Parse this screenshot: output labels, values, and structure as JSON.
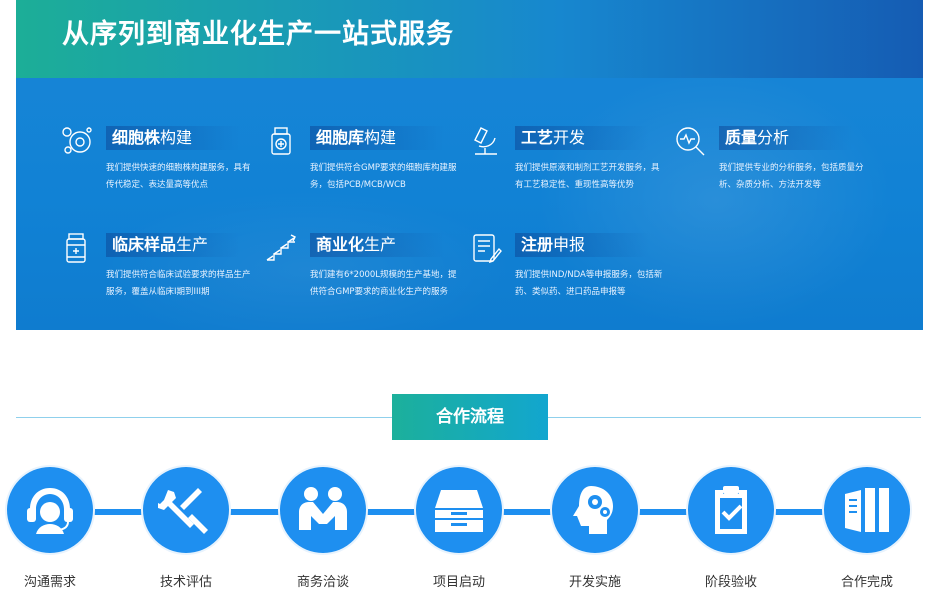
{
  "banner": {
    "title": "从序列到商业化生产一站式服务",
    "services": [
      {
        "icon": "cell-line-icon",
        "name_bold": "细胞株",
        "name_rest": "构建",
        "desc": "我们提供快速的细胞株构建服务，具有传代稳定、表达量高等优点"
      },
      {
        "icon": "cell-bank-icon",
        "name_bold": "细胞库",
        "name_rest": "构建",
        "desc": "我们提供符合GMP要求的细胞库构建服务，包括PCB/MCB/WCB"
      },
      {
        "icon": "microscope-icon",
        "name_bold": "工艺",
        "name_rest": "开发",
        "desc": "我们提供原液和制剂工艺开发服务，具有工艺稳定性、重现性高等优势"
      },
      {
        "icon": "analysis-icon",
        "name_bold": "质量",
        "name_rest": "分析",
        "desc": "我们提供专业的分析服务，包括质量分析、杂质分析、方法开发等"
      },
      {
        "icon": "sample-bottle-icon",
        "name_bold": "临床样品",
        "name_rest": "生产",
        "desc": "我们提供符合临床试验要求的样品生产服务，覆盖从临床I期到III期"
      },
      {
        "icon": "stairs-icon",
        "name_bold": "商业化",
        "name_rest": "生产",
        "desc": "我们建有6*2000L规模的生产基地，提供符合GMP要求的商业化生产的服务"
      },
      {
        "icon": "document-pen-icon",
        "name_bold": "注册",
        "name_rest": "申报",
        "desc": "我们提供IND/NDA等申报服务，包括新药、类似药、进口药品申报等"
      }
    ]
  },
  "process": {
    "title": "合作流程",
    "steps": [
      {
        "icon": "headset-icon",
        "label": "沟通需求"
      },
      {
        "icon": "tools-icon",
        "label": "技术评估"
      },
      {
        "icon": "handshake-icon",
        "label": "商务洽谈"
      },
      {
        "icon": "tray-icon",
        "label": "项目启动"
      },
      {
        "icon": "head-gears-icon",
        "label": "开发实施"
      },
      {
        "icon": "clipboard-check-icon",
        "label": "阶段验收"
      },
      {
        "icon": "complete-icon",
        "label": "合作完成"
      }
    ]
  },
  "colors": {
    "banner_blue": "#1182d5",
    "flow_blue": "#1e8ff0",
    "title_teal": "#1cb09b"
  }
}
